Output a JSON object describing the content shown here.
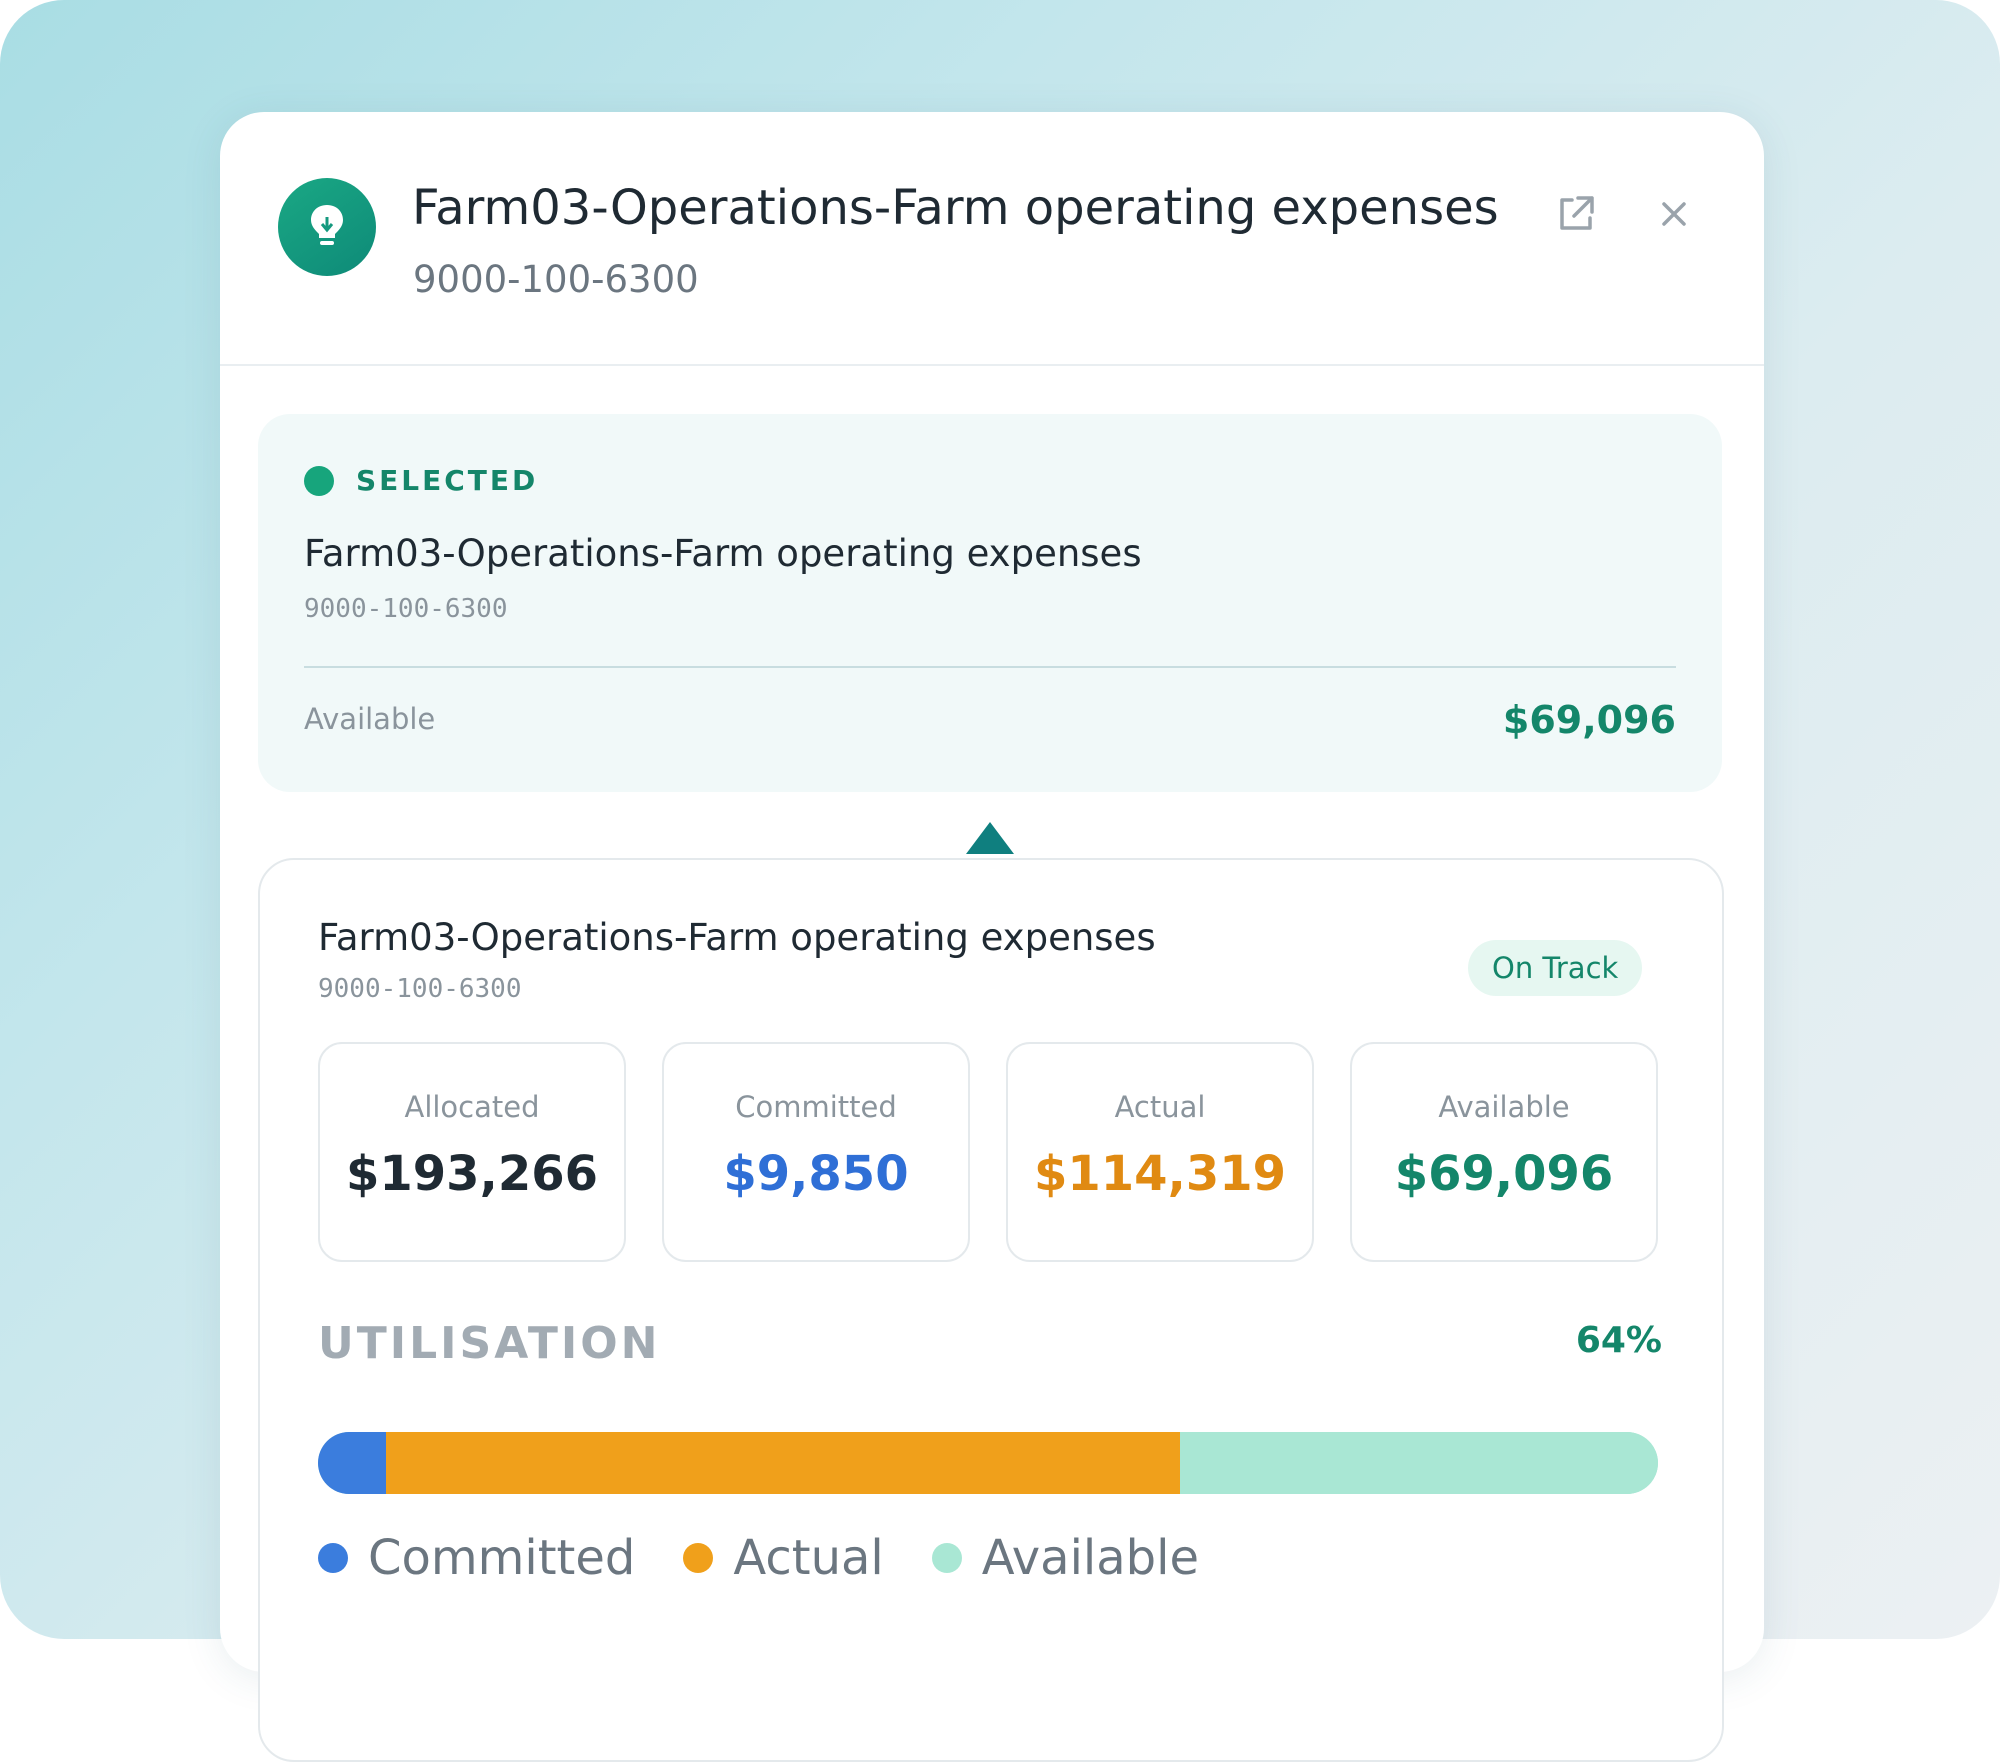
{
  "header": {
    "title": "Farm03-Operations-Farm operating expenses",
    "code": "9000-100-6300",
    "avatar_icon": "lightbulb-icon",
    "open_icon": "external-link-icon",
    "close_icon": "close-icon"
  },
  "selected": {
    "label": "SELECTED",
    "name": "Farm03-Operations-Farm operating expenses",
    "code": "9000-100-6300",
    "available_label": "Available",
    "available_value": "$69,096"
  },
  "detail": {
    "name": "Farm03-Operations-Farm operating expenses",
    "code": "9000-100-6300",
    "status": "On Track",
    "stats": [
      {
        "label": "Allocated",
        "value": "$193,266",
        "color": "#1f2a33"
      },
      {
        "label": "Committed",
        "value": "$9,850",
        "color": "#2f6fd6"
      },
      {
        "label": "Actual",
        "value": "$114,319",
        "color": "#e08a12"
      },
      {
        "label": "Available",
        "value": "$69,096",
        "color": "#14866a"
      }
    ],
    "utilisation": {
      "title": "UTILISATION",
      "percent": "64%",
      "segments": [
        {
          "name": "Committed",
          "fraction": 0.051,
          "color": "#3b7ddd"
        },
        {
          "name": "Actual",
          "fraction": 0.592,
          "color": "#f0a01b"
        },
        {
          "name": "Available",
          "fraction": 0.357,
          "color": "#a9e7d4"
        }
      ]
    },
    "legend": [
      {
        "label": "Committed",
        "color": "#3b7ddd"
      },
      {
        "label": "Actual",
        "color": "#f0a01b"
      },
      {
        "label": "Available",
        "color": "#a9e7d4"
      }
    ]
  }
}
